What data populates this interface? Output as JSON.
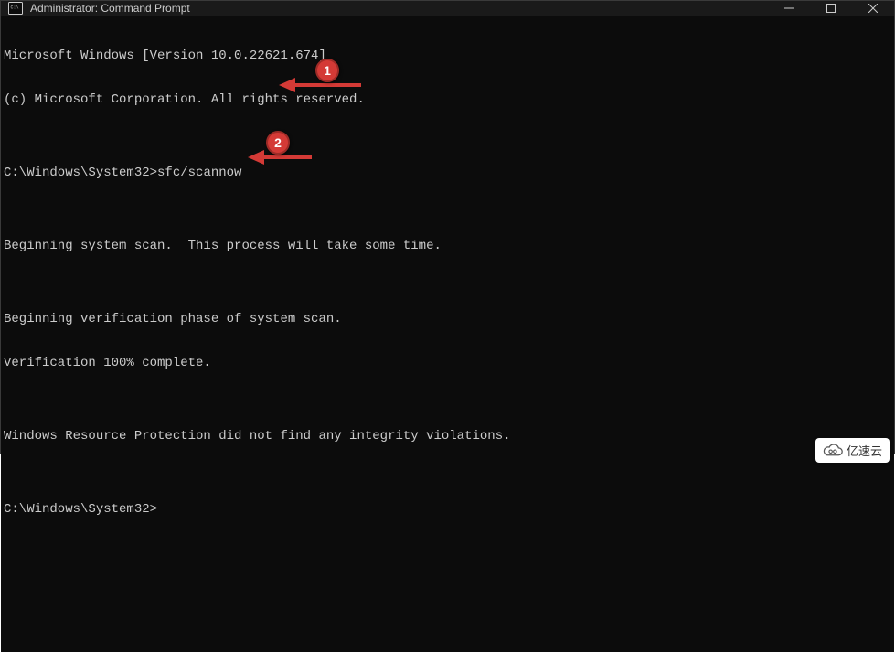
{
  "window": {
    "title": "Administrator: Command Prompt"
  },
  "terminal": {
    "lines": {
      "l0": "Microsoft Windows [Version 10.0.22621.674]",
      "l1": "(c) Microsoft Corporation. All rights reserved.",
      "l2": "",
      "l3_prompt": "C:\\Windows\\System32>",
      "l3_cmd": "sfc/scannow",
      "l4": "",
      "l5": "Beginning system scan.  This process will take some time.",
      "l6": "",
      "l7": "Beginning verification phase of system scan.",
      "l8": "Verification 100% complete.",
      "l9": "",
      "l10": "Windows Resource Protection did not find any integrity violations.",
      "l11": "",
      "l12_prompt": "C:\\Windows\\System32>"
    }
  },
  "annotations": {
    "badge1": "1",
    "badge2": "2"
  },
  "watermark": {
    "text": "亿速云"
  }
}
